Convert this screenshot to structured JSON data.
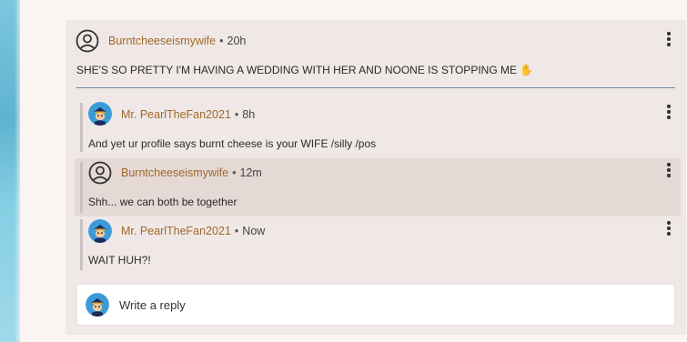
{
  "thread": {
    "parent": {
      "username": "Burntcheeseismywife",
      "time": "20h",
      "text": "SHE'S SO PRETTY I'M HAVING A WEDDING WITH HER AND NOONE IS STOPPING ME ✋",
      "avatar": "default-user-icon"
    },
    "replies": [
      {
        "username": "Mr. PearlTheFan2021",
        "time": "8h",
        "text": "And yet ur profile says burnt cheese is your WIFE /silly /pos",
        "avatar": "character-avatar"
      },
      {
        "username": "Burntcheeseismywife",
        "time": "12m",
        "text": "Shh... we can both be together",
        "avatar": "default-user-icon"
      },
      {
        "username": "Mr. PearlTheFan2021",
        "time": "Now",
        "text": "WAIT HUH?!",
        "avatar": "character-avatar"
      }
    ],
    "separator": "•"
  },
  "reply_input": {
    "placeholder": "Write a reply",
    "avatar": "character-avatar"
  },
  "colors": {
    "username": "#a0682c",
    "card_bg": "#f0e8e6",
    "highlight_bg": "#e5d9d5",
    "divider": "#6f86a3"
  }
}
